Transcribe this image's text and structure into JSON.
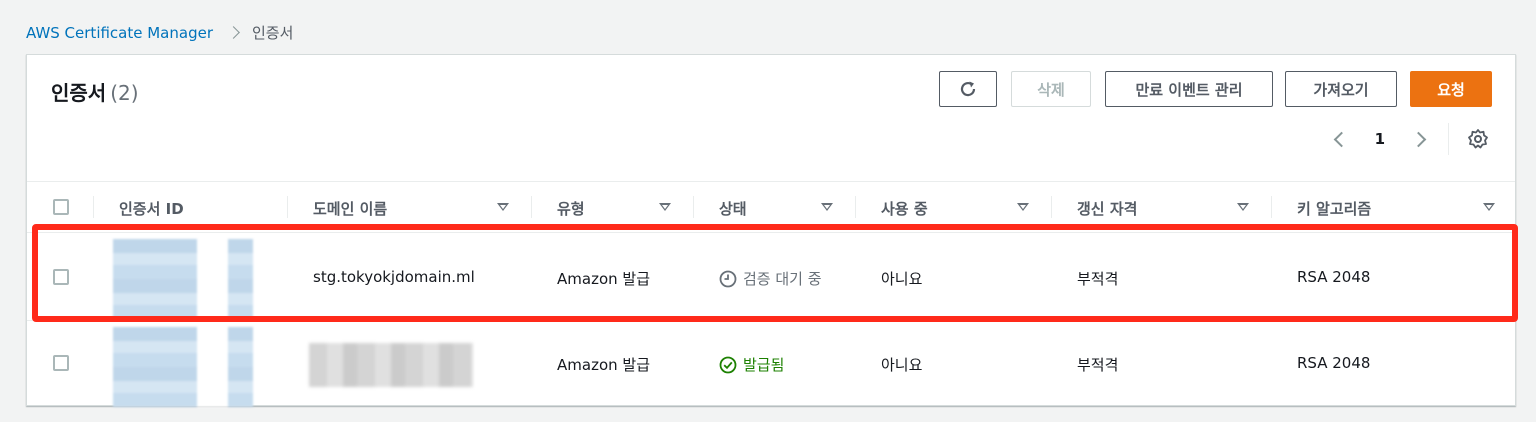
{
  "breadcrumb": {
    "service": "AWS Certificate Manager",
    "current": "인증서"
  },
  "panel": {
    "title": "인증서",
    "count": "(2)"
  },
  "toolbar": {
    "refresh_icon": "refresh-icon",
    "delete_label": "삭제",
    "manage_expiry_label": "만료 이벤트 관리",
    "import_label": "가져오기",
    "request_label": "요청"
  },
  "pagination": {
    "current_page": "1"
  },
  "table": {
    "columns": [
      "인증서 ID",
      "도메인 이름",
      "유형",
      "상태",
      "사용 중",
      "갱신 자격",
      "키 알고리즘"
    ],
    "rows": [
      {
        "certificate_id": "",
        "domain": "stg.tokyokjdomain.ml",
        "type": "Amazon 발급",
        "status": "검증 대기 중",
        "status_icon": "clock-icon",
        "in_use": "아니요",
        "renewal": "부적격",
        "key_algorithm": "RSA 2048"
      },
      {
        "certificate_id": "",
        "domain": "",
        "type": "Amazon 발급",
        "status": "발급됨",
        "status_icon": "check-circle-icon",
        "in_use": "아니요",
        "renewal": "부적격",
        "key_algorithm": "RSA 2048"
      }
    ]
  },
  "colors": {
    "link": "#0073bb",
    "primary_button": "#ec7211",
    "status_issued": "#1d8102",
    "status_pending": "#687078",
    "highlight": "#ff2a1a"
  }
}
